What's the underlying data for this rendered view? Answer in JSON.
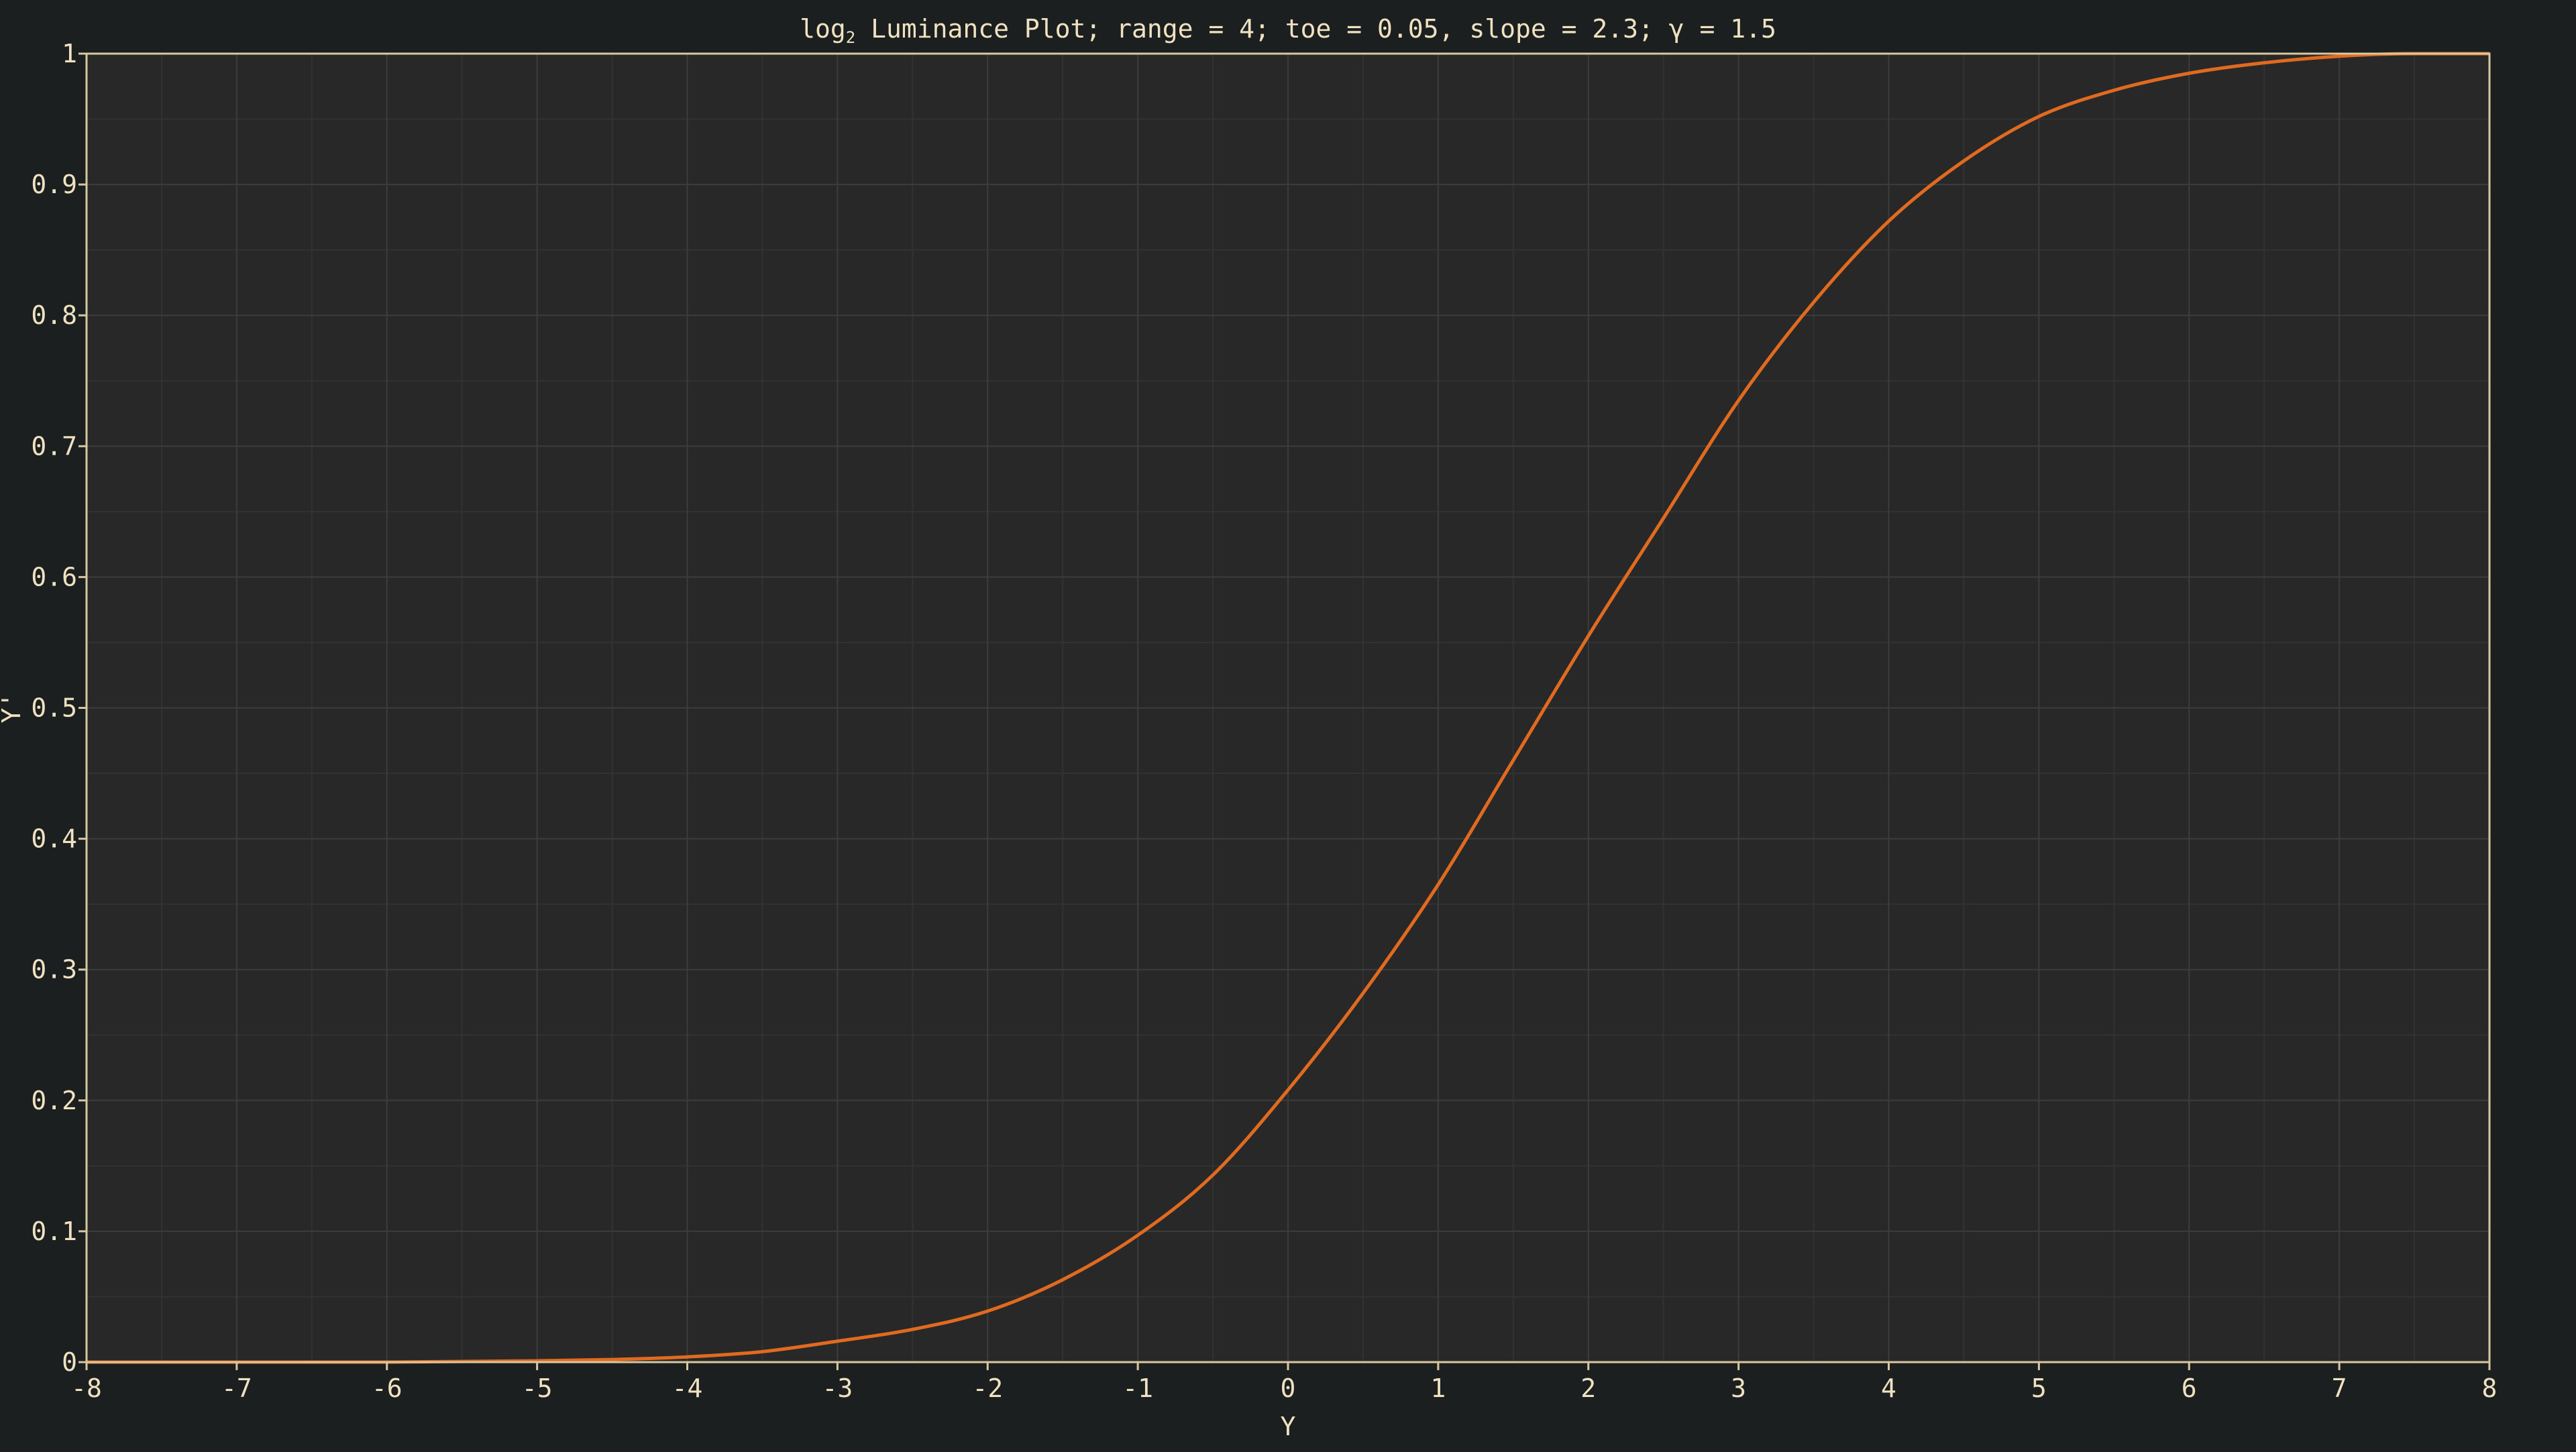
{
  "colors": {
    "page_background": "#1b1f20",
    "plot_background": "#282828",
    "grid_major": "#3c3c3c",
    "grid_minor": "#323232",
    "axis_frame": "#d8c8a0",
    "text": "#f0e2c0",
    "curve": "#e06a1f"
  },
  "chart_data": {
    "type": "line",
    "title": {
      "prefix": "log",
      "subscript": "2",
      "rest": " Luminance Plot; range = 4; toe = 0.05, slope = 2.3; γ = 1.5"
    },
    "xlabel": "Y",
    "ylabel": "Y'",
    "xlim": [
      -8,
      8
    ],
    "ylim": [
      0,
      1
    ],
    "grid": true,
    "xticks": [
      -8,
      -7,
      -6,
      -5,
      -4,
      -3,
      -2,
      -1,
      0,
      1,
      2,
      3,
      4,
      5,
      6,
      7,
      8
    ],
    "xtick_labels": [
      "-8",
      "-7",
      "-6",
      "-5",
      "-4",
      "-3",
      "-2",
      "-1",
      "0",
      "1",
      "2",
      "3",
      "4",
      "5",
      "6",
      "7",
      "8"
    ],
    "yticks": [
      0,
      0.1,
      0.2,
      0.3,
      0.4,
      0.5,
      0.6,
      0.7,
      0.8,
      0.9,
      1
    ],
    "ytick_labels": [
      "0",
      "0.1",
      "0.2",
      "0.3",
      "0.4",
      "0.5",
      "0.6",
      "0.7",
      "0.8",
      "0.9",
      "1"
    ],
    "series": [
      {
        "x": [
          -8,
          -7,
          -6,
          -5,
          -4.5,
          -4,
          -3.5,
          -3,
          -2.5,
          -2,
          -1.5,
          -1,
          -0.5,
          0,
          0.5,
          1,
          1.5,
          2,
          2.5,
          3,
          3.5,
          4,
          4.5,
          5,
          5.5,
          6,
          6.5,
          7,
          7.5,
          8
        ],
        "y": [
          0,
          0,
          0,
          0.001,
          0.002,
          0.004,
          0.008,
          0.016,
          0.025,
          0.039,
          0.063,
          0.097,
          0.143,
          0.208,
          0.282,
          0.365,
          0.46,
          0.555,
          0.645,
          0.735,
          0.81,
          0.872,
          0.918,
          0.952,
          0.972,
          0.985,
          0.993,
          0.998,
          1.0,
          1.0
        ]
      }
    ]
  }
}
